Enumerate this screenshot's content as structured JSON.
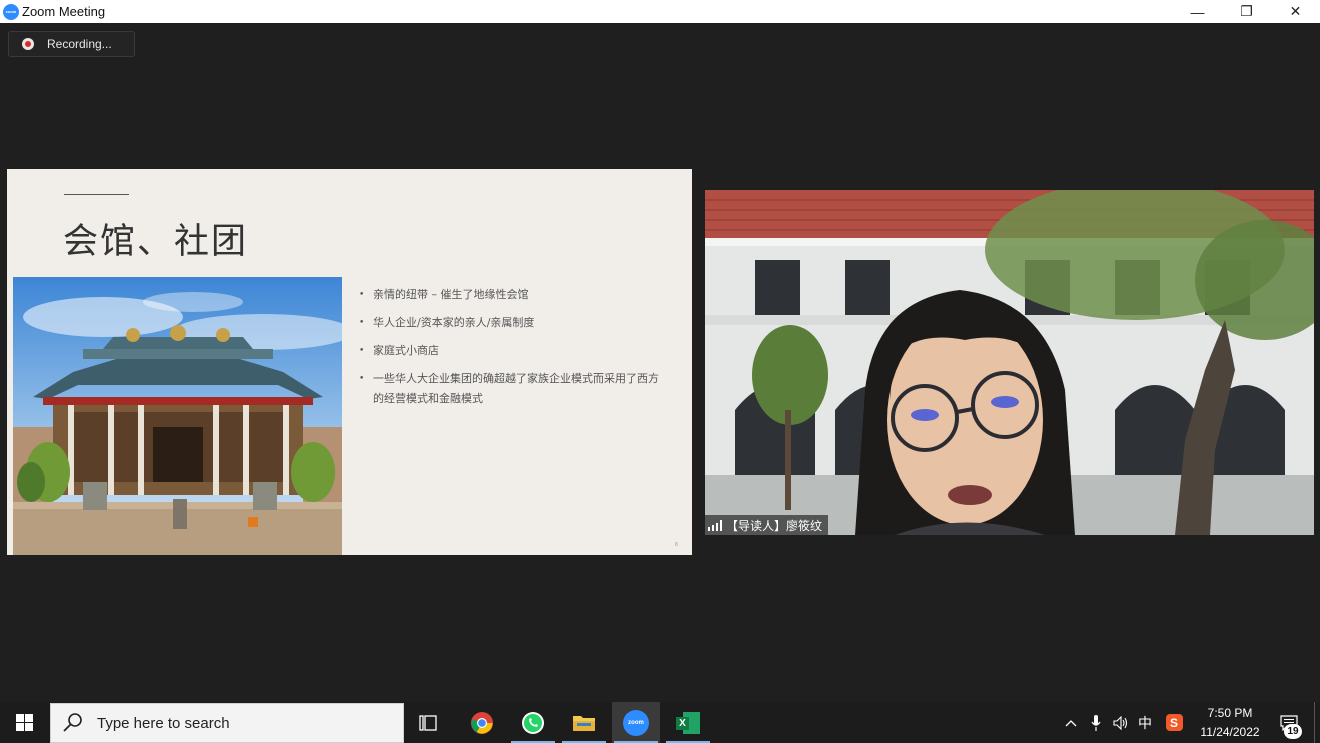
{
  "window": {
    "title": "Zoom Meeting",
    "app_logo_text": "zoom",
    "controls": {
      "minimize": "—",
      "restore": "❐",
      "close": "✕"
    }
  },
  "recording": {
    "label": "Recording..."
  },
  "slide": {
    "title": "会馆、社团",
    "bullets": [
      "亲情的纽带 – 催生了地缘性会馆",
      "华人企业/资本家的亲人/亲属制度",
      "家庭式小商店",
      "一些华人大企业集团的确超越了家族企业模式而采用了西方的经营模式和金融模式"
    ],
    "page_number": "8"
  },
  "video": {
    "participant_name": "【导读人】廖筱纹"
  },
  "taskbar": {
    "search_placeholder": "Type here to search",
    "apps": [
      "task-view",
      "chrome",
      "whatsapp",
      "file-explorer",
      "zoom",
      "excel"
    ],
    "active_app": "zoom",
    "zoom_icon_text": "zoom",
    "excel_icon_text": "X",
    "ime_label": "中",
    "clock_time": "7:50 PM",
    "clock_date": "11/24/2022",
    "notification_count": "19",
    "accent_color": "#77b8ef"
  }
}
